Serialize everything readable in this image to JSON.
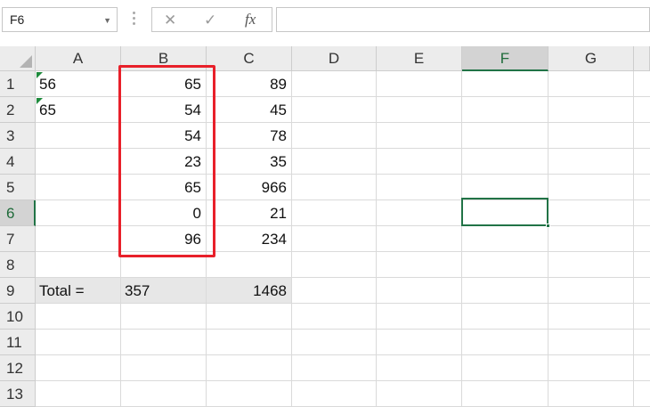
{
  "formula_bar": {
    "name_box": "F6",
    "cancel_icon": "✕",
    "enter_icon": "✓",
    "function_icon": "fx",
    "formula": ""
  },
  "columns": [
    "A",
    "B",
    "C",
    "D",
    "E",
    "F",
    "G"
  ],
  "rows": [
    "1",
    "2",
    "3",
    "4",
    "5",
    "6",
    "7",
    "8",
    "9",
    "10",
    "11",
    "12",
    "13"
  ],
  "cells": {
    "A1": "56",
    "B1": "65",
    "C1": "89",
    "A2": "65",
    "B2": "54",
    "C2": "45",
    "B3": "54",
    "C3": "78",
    "B4": "23",
    "C4": "35",
    "B5": "65",
    "C5": "966",
    "B6": "0",
    "C6": "21",
    "B7": "96",
    "C7": "234",
    "A9": "Total =",
    "B9": "357",
    "C9": "1468"
  },
  "selected_cell": "F6",
  "colors": {
    "accent": "#217346",
    "highlight_border": "#e8202a",
    "header_bg": "#ececec",
    "total_row_bg": "#e7e7e7"
  }
}
